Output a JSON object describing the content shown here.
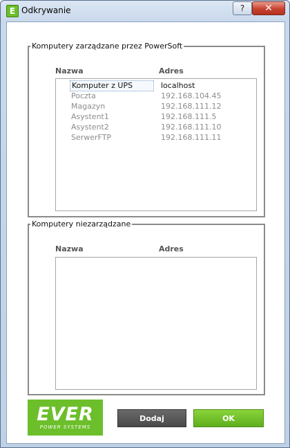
{
  "window": {
    "title": "Odkrywanie",
    "icon_letter": "E",
    "help_label": "?",
    "close_label": "✕"
  },
  "managed": {
    "legend": "Komputery zarządzane przez PowerSoft",
    "col_name": "Nazwa",
    "col_address": "Adres",
    "rows": [
      {
        "name": "Komputer z UPS",
        "address": "localhost",
        "selected": true
      },
      {
        "name": "Poczta",
        "address": "192.168.104.45"
      },
      {
        "name": "Magazyn",
        "address": "192.168.111.12"
      },
      {
        "name": "Asystent1",
        "address": "192.168.111.5"
      },
      {
        "name": "Asystent2",
        "address": "192.168.111.10"
      },
      {
        "name": "SerwerFTP",
        "address": "192.168.111.11"
      }
    ]
  },
  "unmanaged": {
    "legend": "Komputery niezarządzane",
    "col_name": "Nazwa",
    "col_address": "Adres"
  },
  "logo": {
    "main": "EVER",
    "sub": "POWER SYSTEMS"
  },
  "buttons": {
    "add": "Dodaj",
    "ok": "OK"
  }
}
